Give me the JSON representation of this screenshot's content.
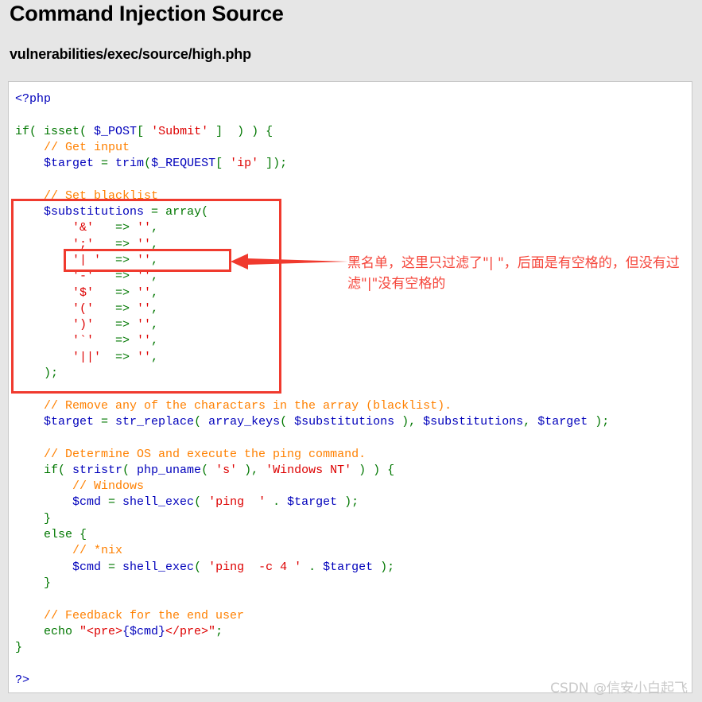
{
  "heading": {
    "title": "Command Injection Source",
    "subtitle": "vulnerabilities/exec/source/high.php"
  },
  "colors": {
    "page_background": "#e6e6e6",
    "code_background": "#ffffff",
    "code_border": "#c8c8c8",
    "annotation_red": "#f03a2e",
    "annotation_text_red": "#f5453a",
    "token_keyword": "#007700",
    "token_variable": "#0000bb",
    "token_string": "#dd0000",
    "token_comment": "#ff8000",
    "watermark": "#c8c8c8"
  },
  "code": {
    "language": "php",
    "lines": [
      [
        {
          "t": "<?php",
          "c": "tag"
        }
      ],
      [],
      [
        {
          "t": "if( ",
          "c": "kw"
        },
        {
          "t": "isset",
          "c": "kw"
        },
        {
          "t": "( ",
          "c": "kw"
        },
        {
          "t": "$_POST",
          "c": "var"
        },
        {
          "t": "[ ",
          "c": "kw"
        },
        {
          "t": "'Submit'",
          "c": "str"
        },
        {
          "t": " ]  ) ) {",
          "c": "kw"
        }
      ],
      [
        {
          "t": "    // Get input",
          "c": "cmt"
        }
      ],
      [
        {
          "t": "    ",
          "c": "kw"
        },
        {
          "t": "$target",
          "c": "var"
        },
        {
          "t": " = ",
          "c": "kw"
        },
        {
          "t": "trim",
          "c": "var"
        },
        {
          "t": "(",
          "c": "kw"
        },
        {
          "t": "$_REQUEST",
          "c": "var"
        },
        {
          "t": "[ ",
          "c": "kw"
        },
        {
          "t": "'ip'",
          "c": "str"
        },
        {
          "t": " ]);",
          "c": "kw"
        }
      ],
      [],
      [
        {
          "t": "    // Set blacklist",
          "c": "cmt"
        }
      ],
      [
        {
          "t": "    ",
          "c": "kw"
        },
        {
          "t": "$substitutions",
          "c": "var"
        },
        {
          "t": " = ",
          "c": "kw"
        },
        {
          "t": "array",
          "c": "kw"
        },
        {
          "t": "(",
          "c": "kw"
        }
      ],
      [
        {
          "t": "        ",
          "c": "kw"
        },
        {
          "t": "'&'",
          "c": "str"
        },
        {
          "t": "   => ",
          "c": "kw"
        },
        {
          "t": "''",
          "c": "str"
        },
        {
          "t": ",",
          "c": "kw"
        }
      ],
      [
        {
          "t": "        ",
          "c": "kw"
        },
        {
          "t": "';'",
          "c": "str"
        },
        {
          "t": "   => ",
          "c": "kw"
        },
        {
          "t": "''",
          "c": "str"
        },
        {
          "t": ",",
          "c": "kw"
        }
      ],
      [
        {
          "t": "        ",
          "c": "kw"
        },
        {
          "t": "'| '",
          "c": "str"
        },
        {
          "t": "  => ",
          "c": "kw"
        },
        {
          "t": "''",
          "c": "str"
        },
        {
          "t": ",",
          "c": "kw"
        }
      ],
      [
        {
          "t": "        ",
          "c": "kw"
        },
        {
          "t": "'-'",
          "c": "str"
        },
        {
          "t": "   => ",
          "c": "kw"
        },
        {
          "t": "''",
          "c": "str"
        },
        {
          "t": ",",
          "c": "kw"
        }
      ],
      [
        {
          "t": "        ",
          "c": "kw"
        },
        {
          "t": "'$'",
          "c": "str"
        },
        {
          "t": "   => ",
          "c": "kw"
        },
        {
          "t": "''",
          "c": "str"
        },
        {
          "t": ",",
          "c": "kw"
        }
      ],
      [
        {
          "t": "        ",
          "c": "kw"
        },
        {
          "t": "'('",
          "c": "str"
        },
        {
          "t": "   => ",
          "c": "kw"
        },
        {
          "t": "''",
          "c": "str"
        },
        {
          "t": ",",
          "c": "kw"
        }
      ],
      [
        {
          "t": "        ",
          "c": "kw"
        },
        {
          "t": "')'",
          "c": "str"
        },
        {
          "t": "   => ",
          "c": "kw"
        },
        {
          "t": "''",
          "c": "str"
        },
        {
          "t": ",",
          "c": "kw"
        }
      ],
      [
        {
          "t": "        ",
          "c": "kw"
        },
        {
          "t": "'`'",
          "c": "str"
        },
        {
          "t": "   => ",
          "c": "kw"
        },
        {
          "t": "''",
          "c": "str"
        },
        {
          "t": ",",
          "c": "kw"
        }
      ],
      [
        {
          "t": "        ",
          "c": "kw"
        },
        {
          "t": "'||'",
          "c": "str"
        },
        {
          "t": "  => ",
          "c": "kw"
        },
        {
          "t": "''",
          "c": "str"
        },
        {
          "t": ",",
          "c": "kw"
        }
      ],
      [
        {
          "t": "    );",
          "c": "kw"
        }
      ],
      [],
      [
        {
          "t": "    // Remove any of the charactars in the array (blacklist).",
          "c": "cmt"
        }
      ],
      [
        {
          "t": "    ",
          "c": "kw"
        },
        {
          "t": "$target",
          "c": "var"
        },
        {
          "t": " = ",
          "c": "kw"
        },
        {
          "t": "str_replace",
          "c": "var"
        },
        {
          "t": "( ",
          "c": "kw"
        },
        {
          "t": "array_keys",
          "c": "var"
        },
        {
          "t": "( ",
          "c": "kw"
        },
        {
          "t": "$substitutions",
          "c": "var"
        },
        {
          "t": " ), ",
          "c": "kw"
        },
        {
          "t": "$substitutions",
          "c": "var"
        },
        {
          "t": ", ",
          "c": "kw"
        },
        {
          "t": "$target",
          "c": "var"
        },
        {
          "t": " );",
          "c": "kw"
        }
      ],
      [],
      [
        {
          "t": "    // Determine OS and execute the ping command.",
          "c": "cmt"
        }
      ],
      [
        {
          "t": "    if( ",
          "c": "kw"
        },
        {
          "t": "stristr",
          "c": "var"
        },
        {
          "t": "( ",
          "c": "kw"
        },
        {
          "t": "php_uname",
          "c": "var"
        },
        {
          "t": "( ",
          "c": "kw"
        },
        {
          "t": "'s'",
          "c": "str"
        },
        {
          "t": " ), ",
          "c": "kw"
        },
        {
          "t": "'Windows NT'",
          "c": "str"
        },
        {
          "t": " ) ) {",
          "c": "kw"
        }
      ],
      [
        {
          "t": "        // Windows",
          "c": "cmt"
        }
      ],
      [
        {
          "t": "        ",
          "c": "kw"
        },
        {
          "t": "$cmd",
          "c": "var"
        },
        {
          "t": " = ",
          "c": "kw"
        },
        {
          "t": "shell_exec",
          "c": "var"
        },
        {
          "t": "( ",
          "c": "kw"
        },
        {
          "t": "'ping  '",
          "c": "str"
        },
        {
          "t": " . ",
          "c": "kw"
        },
        {
          "t": "$target",
          "c": "var"
        },
        {
          "t": " );",
          "c": "kw"
        }
      ],
      [
        {
          "t": "    }",
          "c": "kw"
        }
      ],
      [
        {
          "t": "    else {",
          "c": "kw"
        }
      ],
      [
        {
          "t": "        // *nix",
          "c": "cmt"
        }
      ],
      [
        {
          "t": "        ",
          "c": "kw"
        },
        {
          "t": "$cmd",
          "c": "var"
        },
        {
          "t": " = ",
          "c": "kw"
        },
        {
          "t": "shell_exec",
          "c": "var"
        },
        {
          "t": "( ",
          "c": "kw"
        },
        {
          "t": "'ping  -c 4 '",
          "c": "str"
        },
        {
          "t": " . ",
          "c": "kw"
        },
        {
          "t": "$target",
          "c": "var"
        },
        {
          "t": " );",
          "c": "kw"
        }
      ],
      [
        {
          "t": "    }",
          "c": "kw"
        }
      ],
      [],
      [
        {
          "t": "    // Feedback for the end user",
          "c": "cmt"
        }
      ],
      [
        {
          "t": "    echo ",
          "c": "kw"
        },
        {
          "t": "\"<pre>",
          "c": "str"
        },
        {
          "t": "{$cmd}",
          "c": "var"
        },
        {
          "t": "</pre>\"",
          "c": "str"
        },
        {
          "t": ";",
          "c": "kw"
        }
      ],
      [
        {
          "t": "}",
          "c": "kw"
        }
      ],
      [],
      [
        {
          "t": "?>",
          "c": "tag"
        }
      ]
    ]
  },
  "annotations": {
    "outer_box_label": "blacklist-array-highlight",
    "inner_box_label": "pipe-space-entry-highlight",
    "arrow_label": "callout-arrow-pointing-left",
    "note_text": "黑名单，这里只过滤了\"| \"，后面是有空格的，但没有过滤\"|\"没有空格的"
  },
  "watermark": {
    "text": "CSDN @信安小白起飞"
  }
}
